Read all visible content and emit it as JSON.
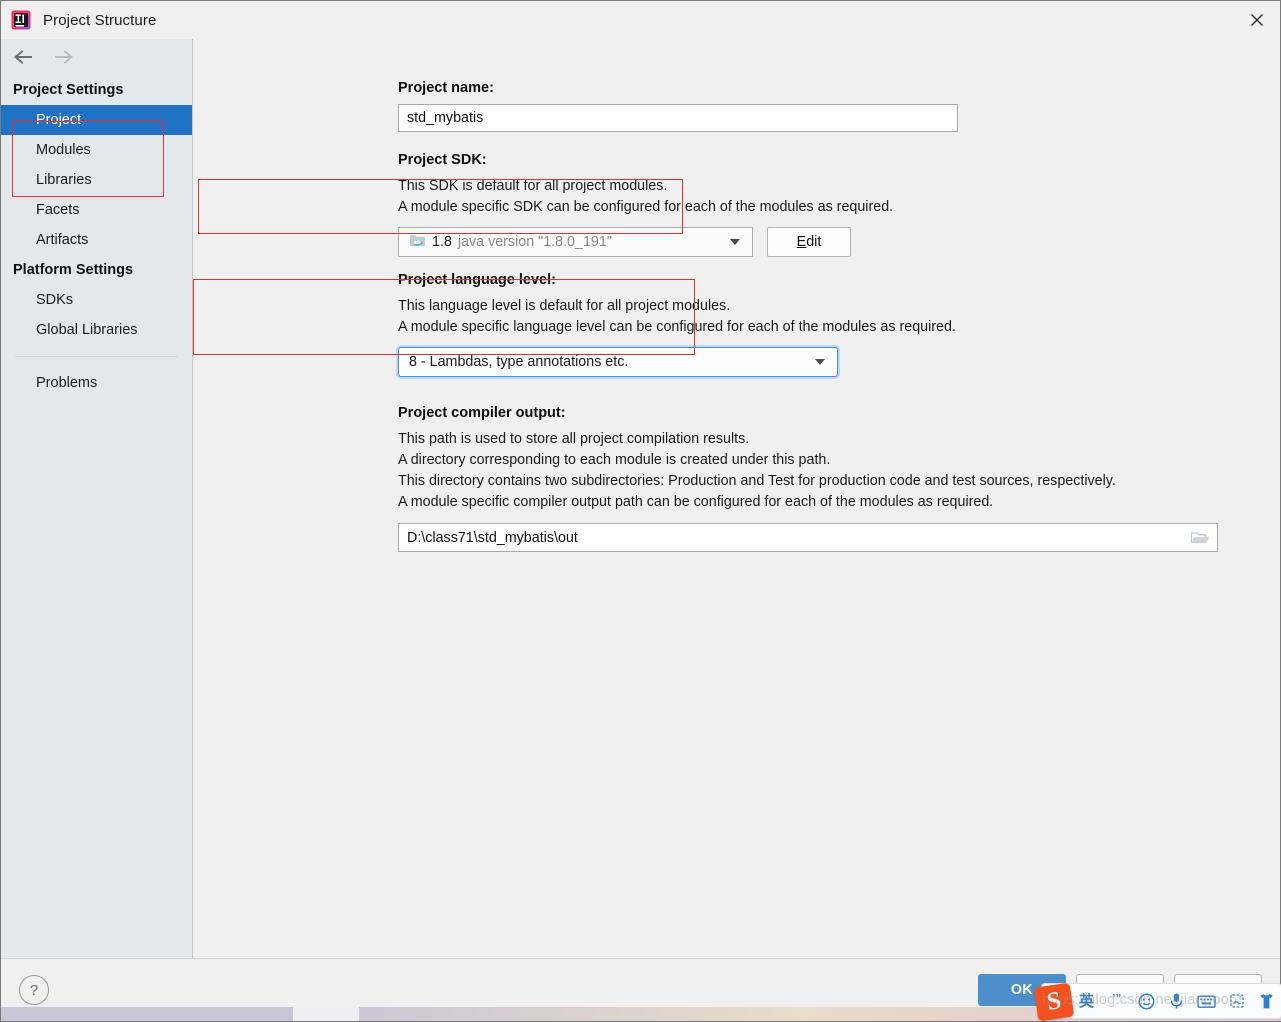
{
  "window": {
    "title": "Project Structure",
    "app_icon": "intellij-idea-icon",
    "close_label": "✕"
  },
  "toolbar": {
    "back_icon": "arrow-left-icon",
    "forward_icon": "arrow-right-icon"
  },
  "sidebar": {
    "groups": [
      {
        "title": "Project Settings",
        "items": [
          {
            "label": "Project",
            "selected": true
          },
          {
            "label": "Modules",
            "selected": false
          },
          {
            "label": "Libraries",
            "selected": false
          },
          {
            "label": "Facets",
            "selected": false
          },
          {
            "label": "Artifacts",
            "selected": false
          }
        ]
      },
      {
        "title": "Platform Settings",
        "items": [
          {
            "label": "SDKs",
            "selected": false
          },
          {
            "label": "Global Libraries",
            "selected": false
          }
        ]
      }
    ],
    "problems_label": "Problems"
  },
  "main": {
    "project_name": {
      "label": "Project name:",
      "value": "std_mybatis"
    },
    "project_sdk": {
      "label": "Project SDK:",
      "desc_1": "This SDK is default for all project modules.",
      "desc_2": "A module specific SDK can be configured for each of the modules as required.",
      "sdk_icon": "java-sdk-folder-icon",
      "sdk_name": "1.8",
      "sdk_version": "java version \"1.8.0_191\"",
      "edit_button": "Edit",
      "edit_mnemonic": "E",
      "edit_rest": "dit",
      "dropdown_icon": "chevron-down-icon"
    },
    "language_level": {
      "label": "Project language level:",
      "desc_1": "This language level is default for all project modules.",
      "desc_2": "A module specific language level can be configured for each of the modules as required.",
      "value": "8 - Lambdas, type annotations etc.",
      "dropdown_icon": "chevron-down-icon"
    },
    "compiler_output": {
      "label": "Project compiler output:",
      "desc_1": "This path is used to store all project compilation results.",
      "desc_2": "A directory corresponding to each module is created under this path.",
      "desc_3": "This directory contains two subdirectories: Production and Test for production code and test sources, respectively.",
      "desc_4": "A module specific compiler output path can be configured for each of the modules as required.",
      "value": "D:\\class71\\std_mybatis\\out",
      "browse_icon": "folder-browse-icon"
    }
  },
  "footer": {
    "help_label": "?",
    "help_icon": "help-question-icon",
    "ok_label": "OK",
    "cancel_label": "",
    "apply_label": ""
  },
  "ime_toolbar": {
    "logo_text": "S",
    "logo_name": "sogou-logo-icon",
    "icons": [
      {
        "name": "language-mode-icon",
        "glyph": "英"
      },
      {
        "name": "punctuation-icon",
        "glyph": "’”"
      },
      {
        "name": "emoji-icon",
        "glyph": "☺"
      },
      {
        "name": "voice-input-icon",
        "glyph": "♁"
      },
      {
        "name": "soft-keyboard-icon",
        "glyph": "⌨"
      },
      {
        "name": "handwriting-icon",
        "glyph": "✎"
      },
      {
        "name": "toolbox-icon",
        "glyph": "♟"
      },
      {
        "name": "menu-icon",
        "glyph": "☰"
      }
    ],
    "watermark": "https://blog.csdn.net/jiangoo6"
  },
  "annotations": {
    "accent_color": "#e03030",
    "selection_color": "#1f72c4",
    "boxes": [
      {
        "name": "sidebar-highlight-box"
      },
      {
        "name": "sdk-highlight-box"
      },
      {
        "name": "language-level-highlight-box"
      }
    ]
  }
}
